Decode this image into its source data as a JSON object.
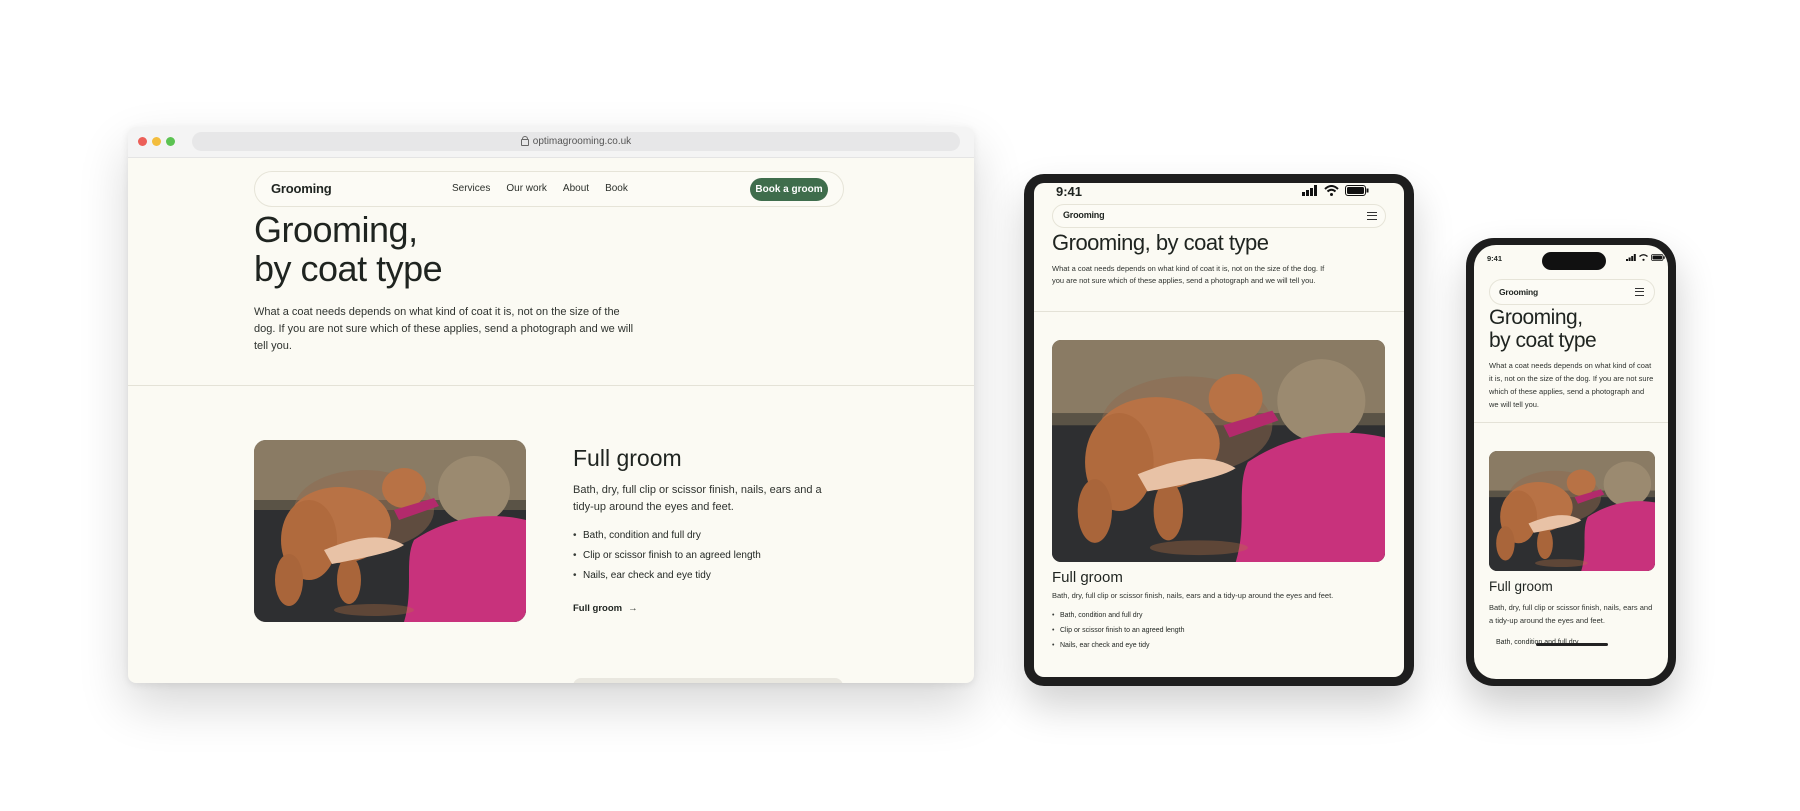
{
  "colors": {
    "accent": "#3f6d4c",
    "page_bg": "#fbfaf3",
    "device_frame": "#1e1e1e"
  },
  "desktop": {
    "url": "optimagrooming.co.uk",
    "brand": "Grooming",
    "nav": [
      "Services",
      "Our work",
      "About",
      "Book"
    ],
    "cta": "Book a groom",
    "hero_line1": "Grooming,",
    "hero_line2": "by coat type",
    "hero_text": "What a coat needs depends on what kind of coat it is, not on the size of the dog. If you are not sure which of these applies, send a photograph and we will tell you.",
    "section_title": "Full groom",
    "section_text": "Bath, dry, full clip or scissor finish, nails, ears and a tidy-up around the eyes and feet.",
    "bullets": [
      "Bath, condition and full dry",
      "Clip or scissor finish to an agreed length",
      "Nails, ear check and eye tidy"
    ],
    "link": "Full groom",
    "link_arrow": "→"
  },
  "tablet": {
    "time": "9:41",
    "brand": "Grooming",
    "hero_title": "Grooming, by coat type",
    "hero_text": "What a coat needs depends on what kind of coat it is, not on the size of the dog. If you are not sure which of these applies, send a photograph and we will tell you.",
    "section_title": "Full groom",
    "section_text": "Bath, dry, full clip or scissor finish, nails, ears and a tidy-up around the eyes and feet.",
    "bullets": [
      "Bath, condition and full dry",
      "Clip or scissor finish to an agreed length",
      "Nails, ear check and eye tidy"
    ]
  },
  "phone": {
    "time": "9:41",
    "brand": "Grooming",
    "hero_line1": "Grooming,",
    "hero_line2": "by coat type",
    "hero_text": "What a coat needs depends on what kind of coat it is, not on the size of the dog. If you are not sure which of these applies, send a photograph and we will tell you.",
    "section_title": "Full groom",
    "section_text": "Bath, dry, full clip or scissor finish, nails, ears and a tidy-up around the eyes and feet.",
    "bullet1": "Bath, condition and full dry"
  }
}
